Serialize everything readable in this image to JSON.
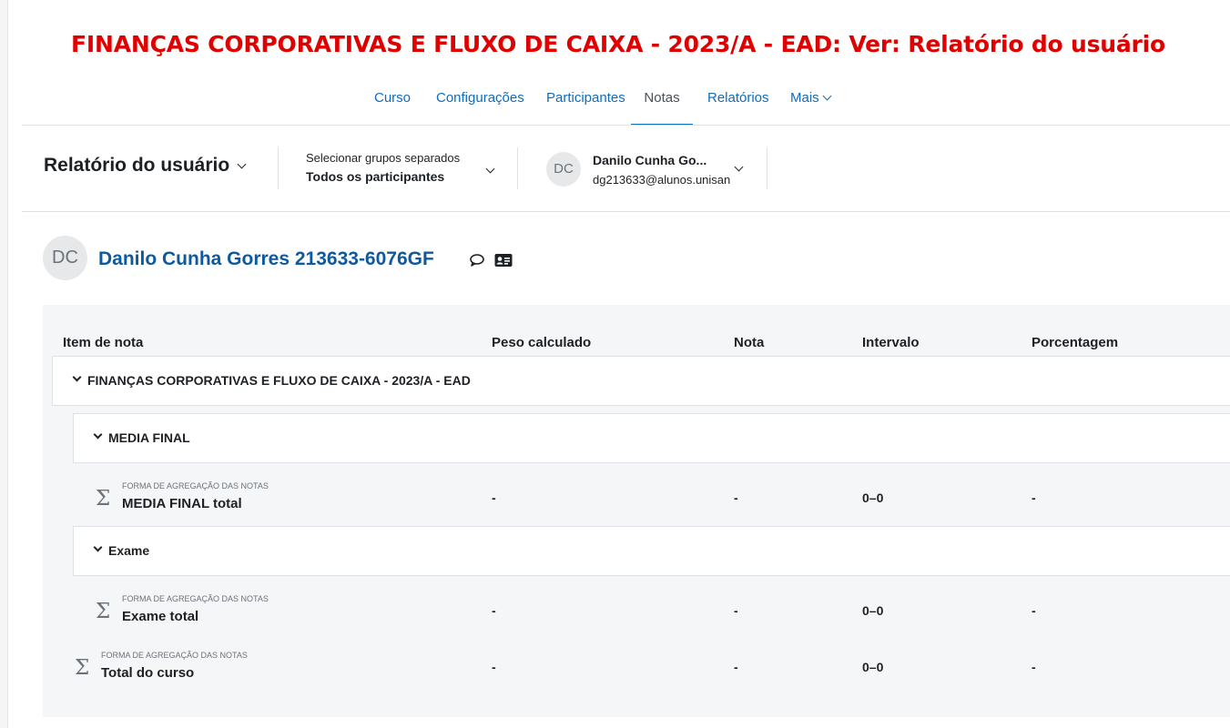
{
  "page": {
    "title": "FINANÇAS CORPORATIVAS E FLUXO DE CAIXA - 2023/A - EAD: Ver: Relatório do usuário"
  },
  "nav": {
    "tabs": [
      "Curso",
      "Configurações",
      "Participantes",
      "Notas",
      "Relatórios",
      "Mais"
    ],
    "active": "Notas"
  },
  "tertiary": {
    "report_label": "Relatório do usuário",
    "group_label": "Selecionar grupos separados",
    "group_value": "Todos os participantes",
    "user_initials": "DC",
    "user_name": "Danilo Cunha Go...",
    "user_email": "dg213633@alunos.unisan"
  },
  "user": {
    "initials": "DC",
    "fullname": "Danilo Cunha Gorres 213633-6076GF"
  },
  "icons": {
    "message": "message-icon",
    "profile_card": "id-card-icon",
    "sigma": "sigma-icon"
  },
  "colors": {
    "title_red": "#e00000",
    "link_blue": "#0f6cbf",
    "user_name_blue": "#0f5a9e"
  },
  "table": {
    "headers": [
      "Item de nota",
      "Peso calculado",
      "Nota",
      "Intervalo",
      "Porcentagem"
    ],
    "course_category": "FINANÇAS CORPORATIVAS E FLUXO DE CAIXA - 2023/A - EAD",
    "categories": [
      {
        "name": "MEDIA FINAL",
        "total": {
          "agg_label": "FORMA DE AGREGAÇÃO DAS NOTAS",
          "name": "MEDIA FINAL total",
          "weight": "-",
          "grade": "-",
          "range": "0–0",
          "percentage": "-"
        }
      },
      {
        "name": "Exame",
        "total": {
          "agg_label": "FORMA DE AGREGAÇÃO DAS NOTAS",
          "name": "Exame total",
          "weight": "-",
          "grade": "-",
          "range": "0–0",
          "percentage": "-"
        }
      }
    ],
    "course_total": {
      "agg_label": "FORMA DE AGREGAÇÃO DAS NOTAS",
      "name": "Total do curso",
      "weight": "-",
      "grade": "-",
      "range": "0–0",
      "percentage": "-"
    }
  }
}
